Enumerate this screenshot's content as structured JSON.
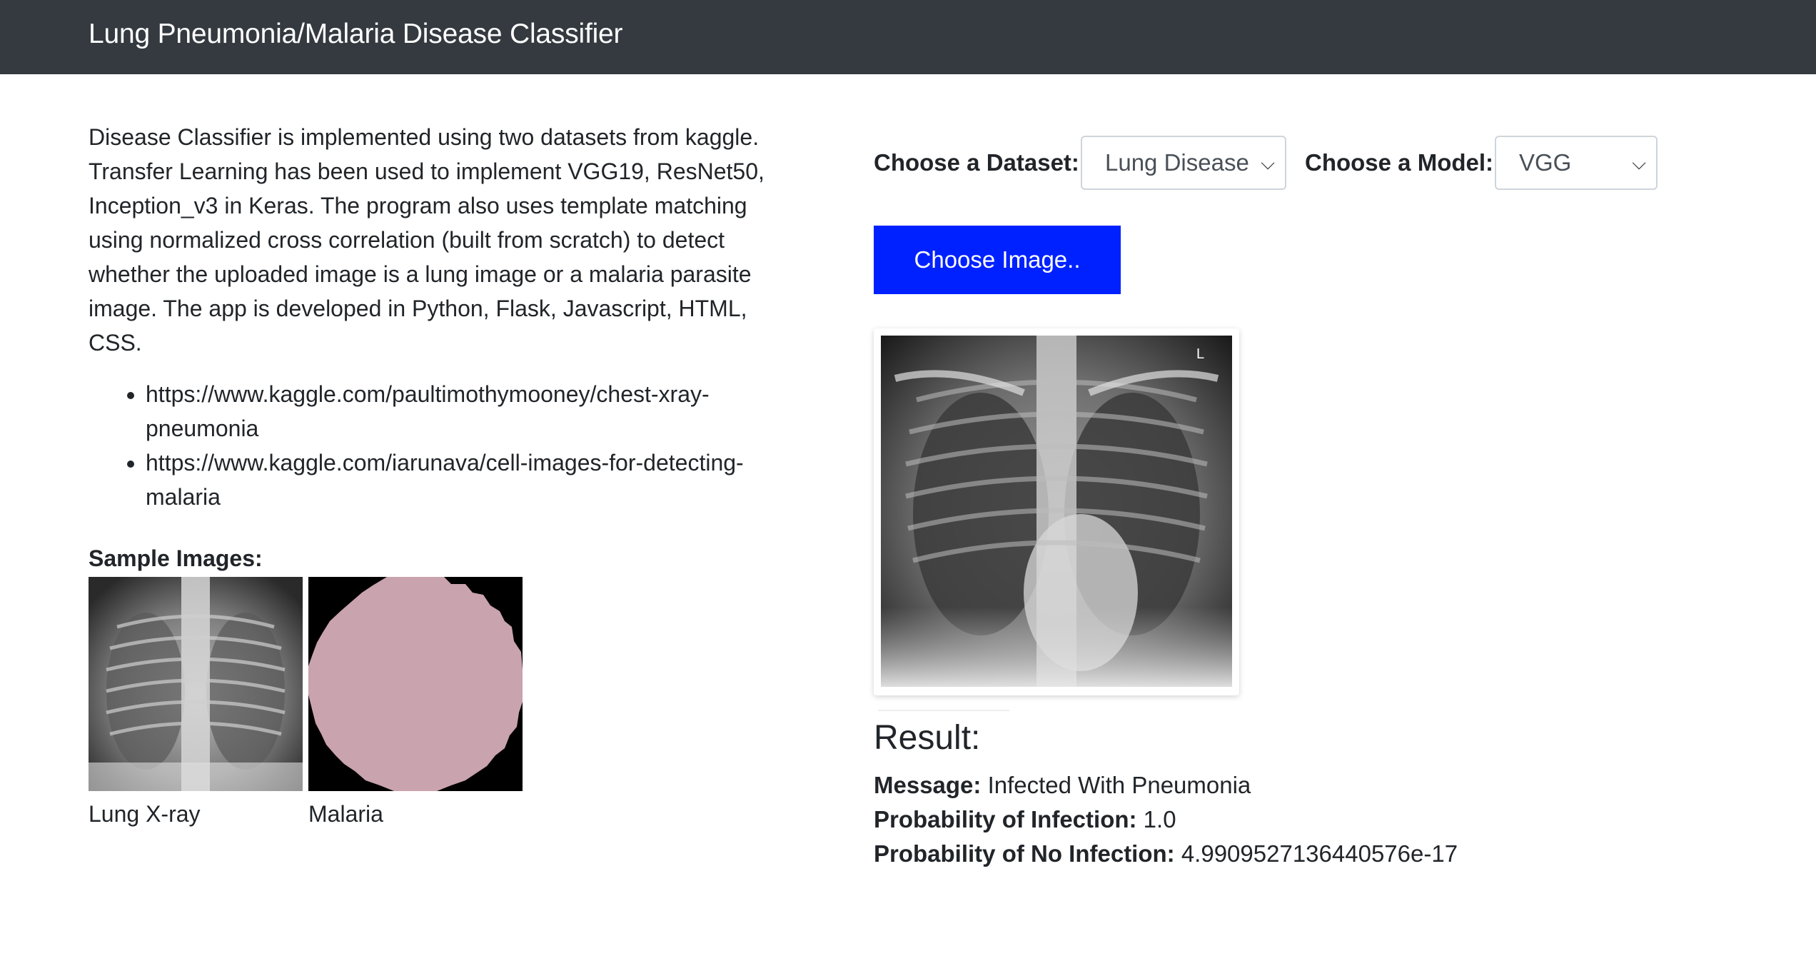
{
  "navbar": {
    "brand": "Lung Pneumonia/Malaria Disease Classifier"
  },
  "intro": {
    "paragraph": "Disease Classifier is implemented using two datasets from kaggle. Transfer Learning has been used to implement VGG19, ResNet50, Inception_v3 in Keras. The program also uses template matching using normalized cross correlation (built from scratch) to detect whether the uploaded image is a lung image or a malaria parasite image. The app is developed in Python, Flask, Javascript, HTML, CSS.",
    "links": [
      "https://www.kaggle.com/paultimothymooney/chest-xray-pneumonia",
      "https://www.kaggle.com/iarunava/cell-images-for-detecting-malaria"
    ]
  },
  "samples": {
    "title": "Sample Images:",
    "items": [
      {
        "caption": "Lung X-ray"
      },
      {
        "caption": "Malaria"
      }
    ]
  },
  "controls": {
    "dataset_label": "Choose a Dataset:",
    "dataset_value": "Lung Disease",
    "model_label": "Choose a Model:",
    "model_value": "VGG",
    "choose_button": "Choose Image..",
    "preview_marker": "L"
  },
  "result": {
    "title": "Result:",
    "message_label": "Message:",
    "message_value": "Infected With Pneumonia",
    "prob_infection_label": "Probability of Infection:",
    "prob_infection_value": "1.0",
    "prob_no_infection_label": "Probability of No Infection:",
    "prob_no_infection_value": "4.9909527136440576e-17"
  },
  "colors": {
    "navbar": "#343a40",
    "button": "#0021ff",
    "malaria_cell": "#c9a3ad"
  }
}
